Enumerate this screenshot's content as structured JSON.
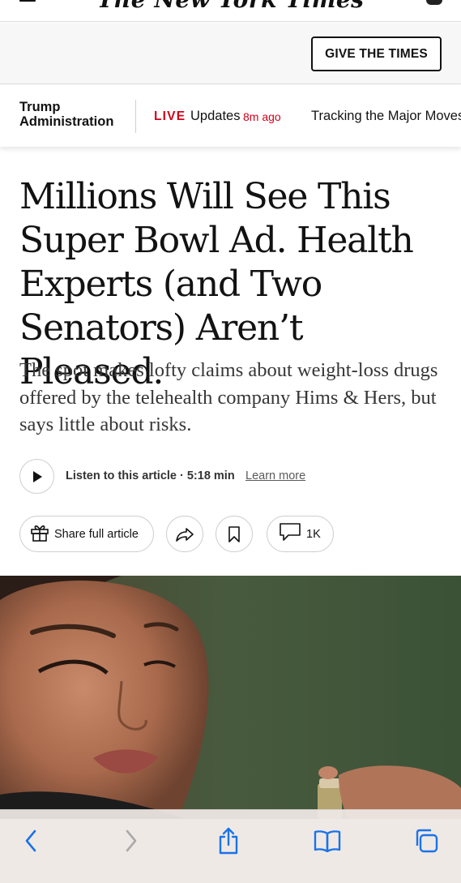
{
  "masthead": {
    "logo": "The New York Times",
    "menu_icon": "hamburger-menu-icon",
    "account_icon": "account-icon"
  },
  "promo": {
    "button_label": "GIVE THE TIMES"
  },
  "live_bar": {
    "section": [
      "Trump",
      "Administration"
    ],
    "live_label": "LIVE",
    "updates_label": "Updates",
    "time_ago": "8m ago",
    "next_story": "Tracking the Major Moves"
  },
  "article": {
    "headline": "Millions Will See This Super Bowl Ad. Health Experts (and Two Senators) Aren’t Pleased.",
    "summary": "The spot makes lofty claims about weight-loss drugs offered by the telehealth company Hims & Hers, but says little about risks.",
    "audio": {
      "play_icon": "play-icon",
      "listen_label": "Listen to this article · 5:18 min",
      "learn_more": "Learn more"
    },
    "actions": {
      "share_label": "Share full article",
      "share_icon": "gift-icon",
      "forward_icon": "share-arrow-icon",
      "bookmark_icon": "bookmark-icon",
      "comment_icon": "comment-icon",
      "comment_count": "1K"
    }
  },
  "toolbar": {
    "back_icon": "chevron-left-icon",
    "forward_icon": "chevron-right-icon",
    "share_icon": "share-icon",
    "bookmarks_icon": "book-icon",
    "tabs_icon": "tabs-icon"
  },
  "colors": {
    "live_red": "#d0021b",
    "text": "#121212",
    "summary_text": "#363636",
    "ios_blue": "#1a73e8"
  }
}
